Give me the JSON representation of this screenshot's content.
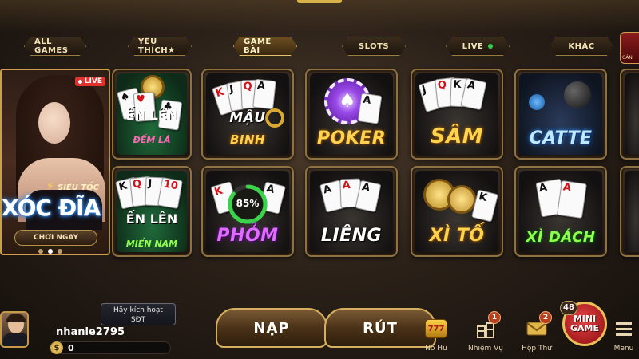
{
  "tabs": [
    {
      "label": "ALL GAMES",
      "active": false
    },
    {
      "label": "YÊU THÍCH★",
      "active": false
    },
    {
      "label": "GAME BÀI",
      "active": true
    },
    {
      "label": "SLOTS",
      "active": false
    },
    {
      "label": "LIVE",
      "active": false
    },
    {
      "label": "KHÁC",
      "active": false
    }
  ],
  "side_tab": {
    "label": "CÁN"
  },
  "featured": {
    "live_badge": "LIVE",
    "subtitle": "SIÊU TỐC",
    "title": "XÓC ĐĨA",
    "play_button": "CHƠI NGAY"
  },
  "games": [
    {
      "title": "ẾN LÊN",
      "subtitle": "ĐẾM LÁ"
    },
    {
      "title": "MẬU",
      "subtitle": "BINH"
    },
    {
      "title": "POKER"
    },
    {
      "title": "SÂM"
    },
    {
      "title": "CATTE"
    },
    {
      "title": "ẾN LÊN",
      "subtitle": "MIỀN NAM"
    },
    {
      "title": "PHỎM",
      "progress_text": "85%",
      "progress": 0.85
    },
    {
      "title": "LIÊNG"
    },
    {
      "title": "XÌ TỐ"
    },
    {
      "title": "XÌ DÁCH"
    }
  ],
  "user": {
    "activate_line1": "Hãy kích hoạt",
    "activate_line2": "SĐT",
    "username": "nhanle2795",
    "balance": "0",
    "currency_symbol": "$"
  },
  "actions": {
    "deposit": "NẠP",
    "withdraw": "RÚT"
  },
  "nav": [
    {
      "label": "Nổ Hũ",
      "icon": "slot-777-icon"
    },
    {
      "label": "Nhiệm Vụ",
      "icon": "gift-boxes-icon",
      "badge": "1"
    },
    {
      "label": "Hộp Thư",
      "icon": "mail-icon",
      "badge": "2"
    },
    {
      "label": "Menu",
      "icon": "hamburger-menu-icon"
    }
  ],
  "minigame": {
    "line1": "MINI",
    "line2": "GAME",
    "count": "48"
  },
  "colors": {
    "accent_gold": "#d6b062",
    "live_red": "#e0322e",
    "online_green": "#34d14a"
  }
}
